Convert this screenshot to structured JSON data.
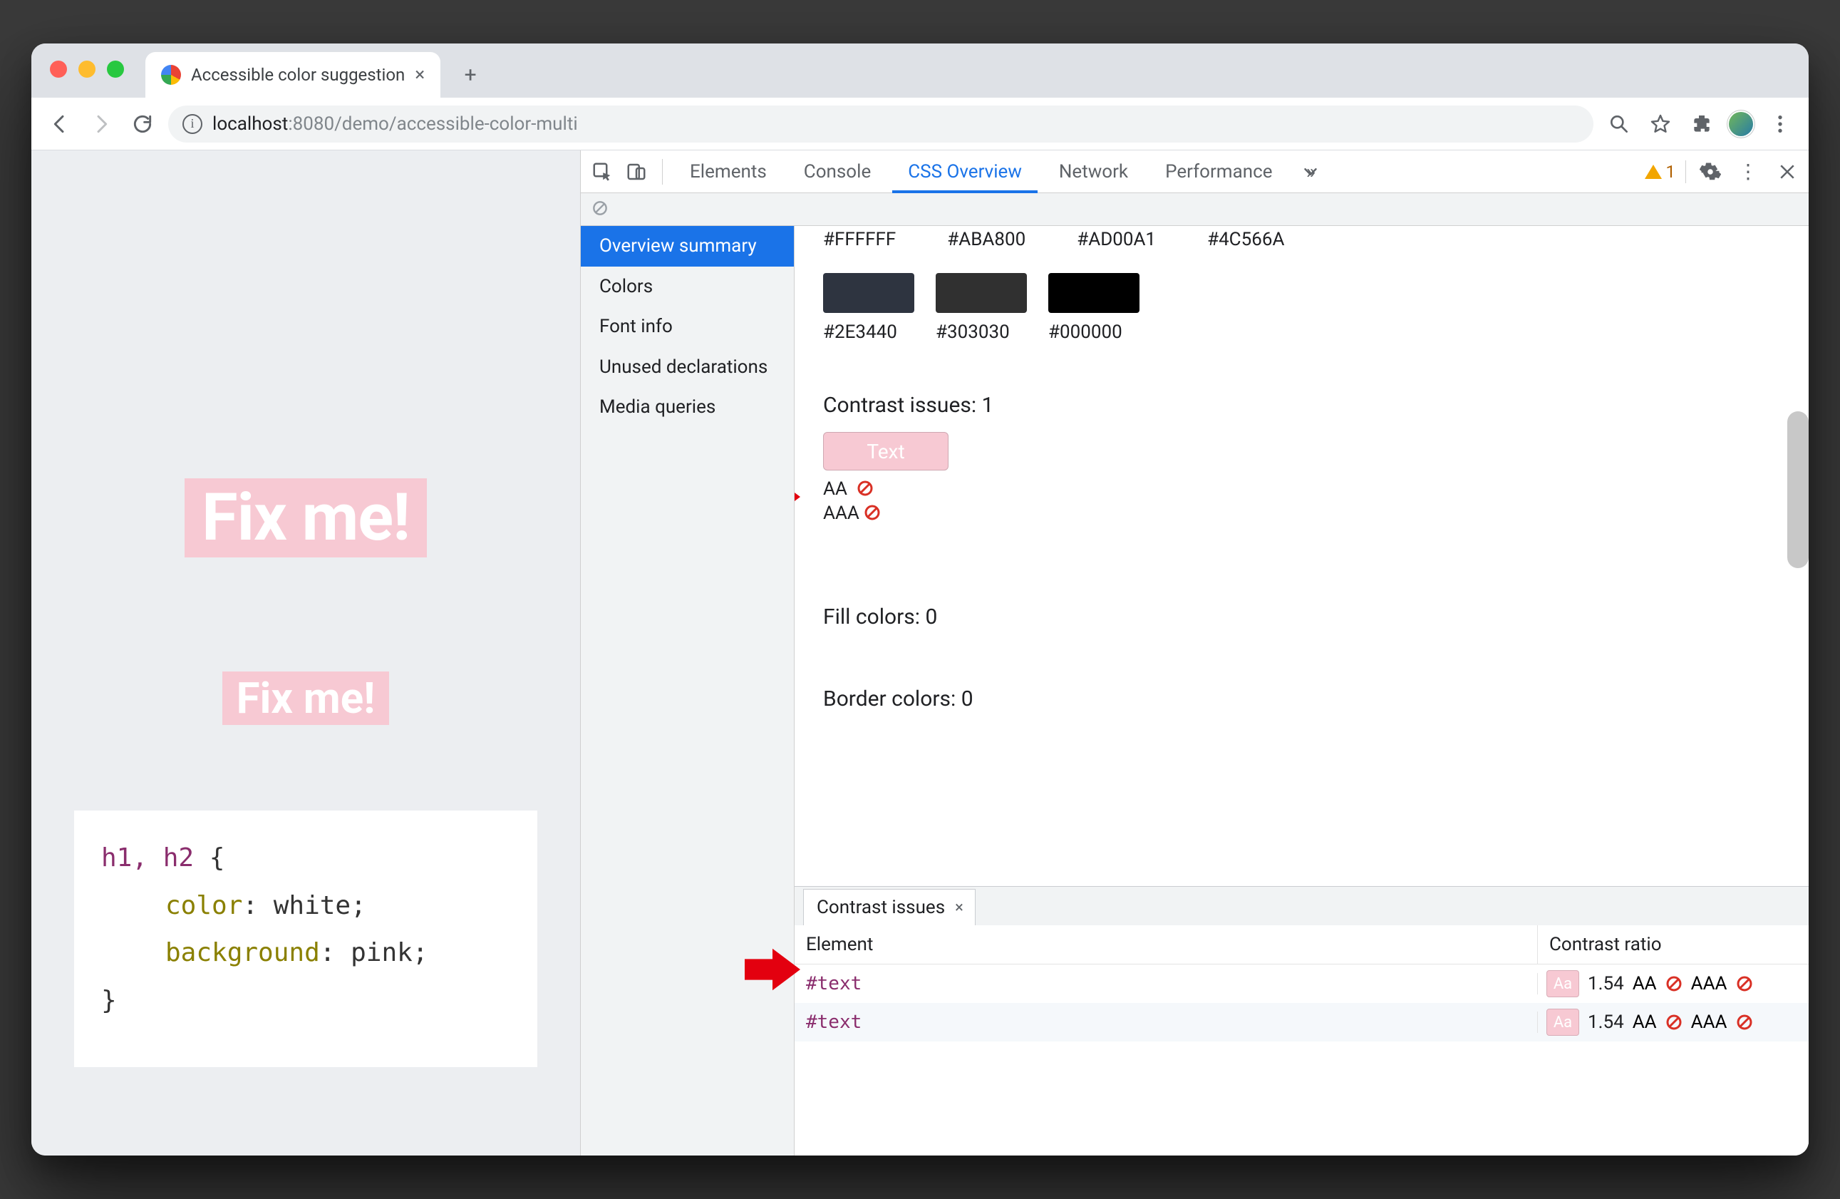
{
  "window": {
    "tab_title": "Accessible color suggestion"
  },
  "toolbar": {
    "url_host": "localhost",
    "url_port": ":8080",
    "url_path": "/demo/accessible-color-multi"
  },
  "page": {
    "h1_text": "Fix me!",
    "h2_text": "Fix me!",
    "code_selector": "h1, h2",
    "code_prop1": "color",
    "code_val1": "white",
    "code_prop2": "background",
    "code_val2": "pink"
  },
  "devtools": {
    "tabs": {
      "elements": "Elements",
      "console": "Console",
      "css_overview": "CSS Overview",
      "network": "Network",
      "performance": "Performance"
    },
    "warning_count": "1",
    "subbar": {},
    "sidebar": {
      "items": [
        {
          "label": "Overview summary"
        },
        {
          "label": "Colors"
        },
        {
          "label": "Font info"
        },
        {
          "label": "Unused declarations"
        },
        {
          "label": "Media queries"
        }
      ]
    },
    "overview": {
      "top_hex": [
        "#FFFFFF",
        "#ABA800",
        "#AD00A1",
        "#4C566A"
      ],
      "swatches2": [
        {
          "hex": "#2E3440",
          "color": "#2E3440"
        },
        {
          "hex": "#303030",
          "color": "#303030"
        },
        {
          "hex": "#000000",
          "color": "#000000"
        }
      ],
      "contrast_heading": "Contrast issues: 1",
      "text_label": "Text",
      "aa_label": "AA",
      "aaa_label": "AAA",
      "fill_heading": "Fill colors: 0",
      "border_heading": "Border colors: 0"
    },
    "drawer": {
      "tab_label": "Contrast issues",
      "col_element": "Element",
      "col_ratio": "Contrast ratio",
      "rows": [
        {
          "el": "#text",
          "swatch": "Aa",
          "ratio": "1.54",
          "aa": "AA",
          "aaa": "AAA"
        },
        {
          "el": "#text",
          "swatch": "Aa",
          "ratio": "1.54",
          "aa": "AA",
          "aaa": "AAA"
        }
      ]
    }
  }
}
